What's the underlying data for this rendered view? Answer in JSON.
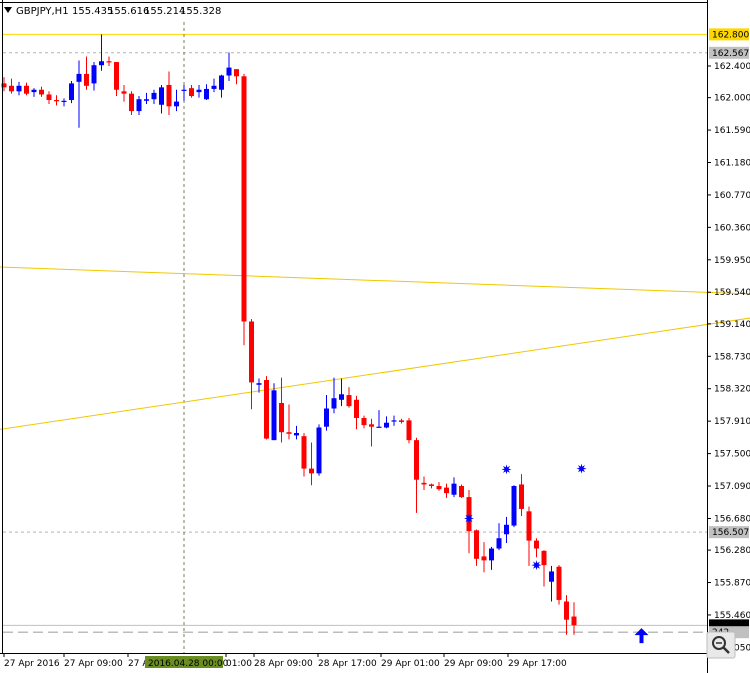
{
  "header": {
    "symbol_timeframe": "GBPJPY,H1",
    "ohlc": [
      "155.435",
      "155.616",
      "155.214",
      "155.328"
    ]
  },
  "colors": {
    "bull": "#0000ff",
    "bear": "#ff0000",
    "hline": "#ffd700",
    "trendline": "#f0c800",
    "grid_dotted": "#b4b4b4",
    "axis": "#000000",
    "crosshair": "#7a7a50",
    "time_tag_bg": "#6b8e23"
  },
  "chart_data": {
    "type": "candlestick",
    "symbol": "GBPJPY",
    "timeframe": "H1",
    "y_ticks": [
      "162.400",
      "162.000",
      "161.590",
      "161.180",
      "160.770",
      "160.360",
      "159.950",
      "159.540",
      "159.140",
      "158.730",
      "158.320",
      "157.910",
      "157.500",
      "157.090",
      "156.680",
      "156.280",
      "155.870",
      "155.460",
      "155.050"
    ],
    "ylim": [
      154.98,
      163.05
    ],
    "x_ticks": [
      "27 Apr 2016",
      "27 Apr 09:00",
      "27 Apr",
      "01:00",
      "28 Apr 09:00",
      "28 Apr 17:00",
      "29 Apr 01:00",
      "29 Apr 09:00",
      "29 Apr 17:00"
    ],
    "time_tag": "2016.04.28 00:00",
    "price_tags": [
      "162.800",
      "162.567",
      "156.507",
      "155.328",
      "242"
    ],
    "horizontal_lines": [
      {
        "price": 162.8,
        "style": "solid"
      },
      {
        "price": 162.567,
        "style": "dotted"
      },
      {
        "price": 156.507,
        "style": "dotted"
      },
      {
        "price": 155.328,
        "style": "solid"
      },
      {
        "price": 155.242,
        "style": "dashed"
      }
    ],
    "trendlines": [
      {
        "from": {
          "bar": -1,
          "price": 159.86
        },
        "to": {
          "bar": 117,
          "price": 159.46
        }
      },
      {
        "from": {
          "bar": -1,
          "price": 157.8
        },
        "to": {
          "bar": 117,
          "price": 159.46
        }
      }
    ],
    "candles": [
      {
        "o": 162.18,
        "h": 162.26,
        "l": 162.08,
        "c": 162.13
      },
      {
        "o": 162.15,
        "h": 162.24,
        "l": 162.05,
        "c": 162.08
      },
      {
        "o": 162.08,
        "h": 162.2,
        "l": 162.03,
        "c": 162.15
      },
      {
        "o": 162.15,
        "h": 162.19,
        "l": 162.03,
        "c": 162.05
      },
      {
        "o": 162.07,
        "h": 162.12,
        "l": 162.01,
        "c": 162.1
      },
      {
        "o": 162.1,
        "h": 162.14,
        "l": 162.01,
        "c": 162.04
      },
      {
        "o": 162.04,
        "h": 162.08,
        "l": 161.92,
        "c": 161.97
      },
      {
        "o": 161.97,
        "h": 162.03,
        "l": 161.9,
        "c": 161.96
      },
      {
        "o": 161.96,
        "h": 161.99,
        "l": 161.89,
        "c": 161.96
      },
      {
        "o": 161.97,
        "h": 162.21,
        "l": 161.93,
        "c": 162.18
      },
      {
        "o": 162.2,
        "h": 162.47,
        "l": 161.62,
        "c": 162.3
      },
      {
        "o": 162.3,
        "h": 162.52,
        "l": 162.1,
        "c": 162.15
      },
      {
        "o": 162.18,
        "h": 162.45,
        "l": 162.09,
        "c": 162.41
      },
      {
        "o": 162.41,
        "h": 162.8,
        "l": 162.34,
        "c": 162.46
      },
      {
        "o": 162.46,
        "h": 162.52,
        "l": 162.4,
        "c": 162.45
      },
      {
        "o": 162.45,
        "h": 162.41,
        "l": 162.02,
        "c": 162.1
      },
      {
        "o": 162.08,
        "h": 162.16,
        "l": 161.95,
        "c": 162.05
      },
      {
        "o": 162.05,
        "h": 162.08,
        "l": 161.78,
        "c": 161.83
      },
      {
        "o": 161.83,
        "h": 162.02,
        "l": 161.78,
        "c": 161.98
      },
      {
        "o": 161.96,
        "h": 162.06,
        "l": 161.92,
        "c": 161.98
      },
      {
        "o": 161.98,
        "h": 162.1,
        "l": 161.92,
        "c": 162.06
      },
      {
        "o": 161.91,
        "h": 162.16,
        "l": 161.8,
        "c": 162.13
      },
      {
        "o": 162.16,
        "h": 162.33,
        "l": 161.78,
        "c": 161.89
      },
      {
        "o": 161.89,
        "h": 162.1,
        "l": 161.83,
        "c": 161.95
      },
      {
        "o": 162.1,
        "h": 162.16,
        "l": 161.96,
        "c": 162.1
      },
      {
        "o": 162.12,
        "h": 162.16,
        "l": 162.0,
        "c": 162.02
      },
      {
        "o": 162.07,
        "h": 162.16,
        "l": 162.0,
        "c": 162.1
      },
      {
        "o": 161.98,
        "h": 162.17,
        "l": 161.97,
        "c": 162.11
      },
      {
        "o": 162.11,
        "h": 162.24,
        "l": 162.07,
        "c": 162.15
      },
      {
        "o": 162.1,
        "h": 162.29,
        "l": 162.0,
        "c": 162.28
      },
      {
        "o": 162.28,
        "h": 162.57,
        "l": 162.21,
        "c": 162.38
      },
      {
        "o": 162.36,
        "h": 162.35,
        "l": 162.17,
        "c": 162.27
      },
      {
        "o": 162.27,
        "h": 162.3,
        "l": 158.87,
        "c": 159.17
      },
      {
        "o": 159.17,
        "h": 159.2,
        "l": 158.06,
        "c": 158.4
      },
      {
        "o": 158.37,
        "h": 158.45,
        "l": 158.27,
        "c": 158.39
      },
      {
        "o": 158.43,
        "h": 158.48,
        "l": 157.68,
        "c": 157.69
      },
      {
        "o": 157.67,
        "h": 158.39,
        "l": 157.67,
        "c": 158.3
      },
      {
        "o": 158.14,
        "h": 158.46,
        "l": 157.64,
        "c": 157.77
      },
      {
        "o": 157.77,
        "h": 158.12,
        "l": 157.68,
        "c": 157.75
      },
      {
        "o": 157.73,
        "h": 157.85,
        "l": 157.68,
        "c": 157.76
      },
      {
        "o": 157.72,
        "h": 157.76,
        "l": 157.21,
        "c": 157.31
      },
      {
        "o": 157.31,
        "h": 157.64,
        "l": 157.1,
        "c": 157.25
      },
      {
        "o": 157.25,
        "h": 157.87,
        "l": 157.22,
        "c": 157.83
      },
      {
        "o": 157.84,
        "h": 158.24,
        "l": 157.79,
        "c": 158.07
      },
      {
        "o": 158.07,
        "h": 158.46,
        "l": 158.01,
        "c": 158.2
      },
      {
        "o": 158.18,
        "h": 158.45,
        "l": 158.1,
        "c": 158.25
      },
      {
        "o": 158.24,
        "h": 158.34,
        "l": 158.08,
        "c": 158.1
      },
      {
        "o": 158.18,
        "h": 158.23,
        "l": 157.81,
        "c": 157.95
      },
      {
        "o": 157.95,
        "h": 157.98,
        "l": 157.82,
        "c": 157.86
      },
      {
        "o": 157.87,
        "h": 157.94,
        "l": 157.59,
        "c": 157.84
      },
      {
        "o": 157.84,
        "h": 158.05,
        "l": 157.83,
        "c": 157.84
      },
      {
        "o": 157.83,
        "h": 157.97,
        "l": 157.82,
        "c": 157.89
      },
      {
        "o": 157.91,
        "h": 157.98,
        "l": 157.85,
        "c": 157.92
      },
      {
        "o": 157.92,
        "h": 157.94,
        "l": 157.88,
        "c": 157.9
      },
      {
        "o": 157.92,
        "h": 157.95,
        "l": 157.63,
        "c": 157.67
      },
      {
        "o": 157.67,
        "h": 157.7,
        "l": 156.75,
        "c": 157.17
      },
      {
        "o": 157.13,
        "h": 157.21,
        "l": 157.04,
        "c": 157.11
      },
      {
        "o": 157.11,
        "h": 157.12,
        "l": 157.06,
        "c": 157.09
      },
      {
        "o": 157.09,
        "h": 157.14,
        "l": 157.03,
        "c": 157.05
      },
      {
        "o": 157.07,
        "h": 157.12,
        "l": 156.94,
        "c": 157.0
      },
      {
        "o": 156.98,
        "h": 157.2,
        "l": 156.95,
        "c": 157.12
      },
      {
        "o": 157.09,
        "h": 157.11,
        "l": 156.94,
        "c": 156.95
      },
      {
        "o": 156.95,
        "h": 157.04,
        "l": 156.24,
        "c": 156.52
      },
      {
        "o": 156.53,
        "h": 156.54,
        "l": 156.08,
        "c": 156.17
      },
      {
        "o": 156.2,
        "h": 156.38,
        "l": 156.0,
        "c": 156.15
      },
      {
        "o": 156.15,
        "h": 156.32,
        "l": 156.03,
        "c": 156.3
      },
      {
        "o": 156.3,
        "h": 156.62,
        "l": 156.28,
        "c": 156.43
      },
      {
        "o": 156.48,
        "h": 156.7,
        "l": 156.37,
        "c": 156.6
      },
      {
        "o": 156.59,
        "h": 157.1,
        "l": 156.57,
        "c": 157.09
      },
      {
        "o": 157.11,
        "h": 157.24,
        "l": 156.71,
        "c": 156.8
      },
      {
        "o": 156.77,
        "h": 156.83,
        "l": 156.08,
        "c": 156.4
      },
      {
        "o": 156.4,
        "h": 156.43,
        "l": 156.19,
        "c": 156.3
      },
      {
        "o": 156.27,
        "h": 156.28,
        "l": 155.82,
        "c": 156.09
      },
      {
        "o": 155.88,
        "h": 156.08,
        "l": 155.63,
        "c": 156.01
      },
      {
        "o": 156.07,
        "h": 156.09,
        "l": 155.59,
        "c": 155.65
      },
      {
        "o": 155.63,
        "h": 155.71,
        "l": 155.21,
        "c": 155.4
      },
      {
        "o": 155.44,
        "h": 155.62,
        "l": 155.21,
        "c": 155.33
      }
    ],
    "markers": [
      {
        "bar": 62,
        "price": 156.68,
        "symbol": "star",
        "color": "blue"
      },
      {
        "bar": 67,
        "price": 157.3,
        "symbol": "star",
        "color": "blue"
      },
      {
        "bar": 71,
        "price": 156.09,
        "symbol": "star",
        "color": "blue"
      },
      {
        "bar": 77,
        "price": 157.31,
        "symbol": "star",
        "color": "blue"
      },
      {
        "bar": 85,
        "price": 155.18,
        "symbol": "arrow-up",
        "color": "blue"
      }
    ]
  }
}
